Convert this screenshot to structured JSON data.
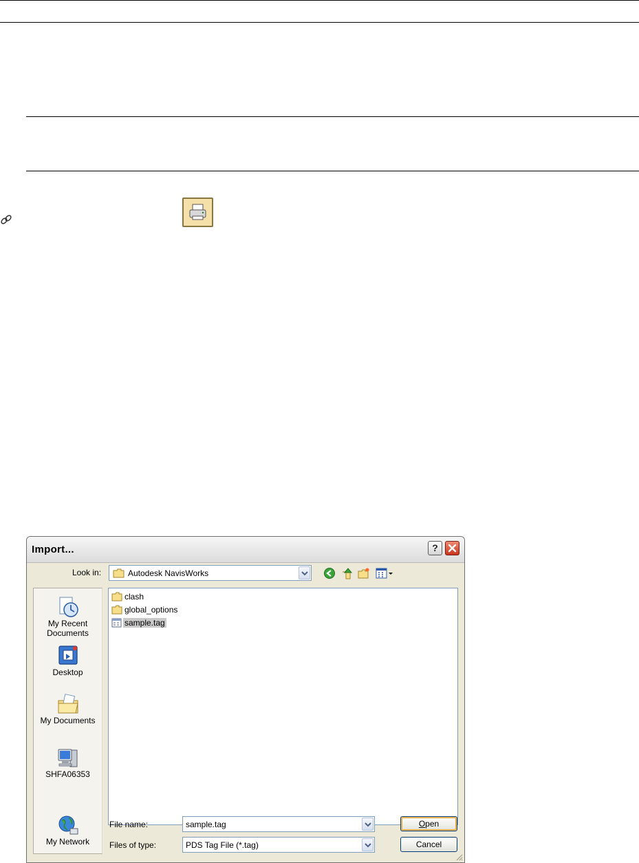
{
  "dialog": {
    "title": "Import...",
    "help_glyph": "?",
    "look_in_label": "Look in:",
    "look_in_value": "Autodesk NavisWorks",
    "places": [
      {
        "label": "My Recent Documents",
        "icon": "recent-documents-icon"
      },
      {
        "label": "Desktop",
        "icon": "desktop-icon"
      },
      {
        "label": "My Documents",
        "icon": "my-documents-icon"
      },
      {
        "label": "SHFA06353",
        "icon": "computer-icon"
      },
      {
        "label": "My Network",
        "icon": "network-icon"
      }
    ],
    "files": [
      {
        "name": "clash",
        "type": "folder"
      },
      {
        "name": "global_options",
        "type": "folder"
      },
      {
        "name": "sample.tag",
        "type": "file",
        "selected": true
      }
    ],
    "file_name_label": "File name:",
    "file_name_value": "sample.tag",
    "files_of_type_label": "Files of type:",
    "files_of_type_value": "PDS Tag File (*.tag)",
    "open_button": {
      "accel": "O",
      "rest": "pen"
    },
    "cancel_button": "Cancel"
  },
  "colors": {
    "title_close": "#c8361e",
    "print_button_bg": "#f6e0a9"
  }
}
